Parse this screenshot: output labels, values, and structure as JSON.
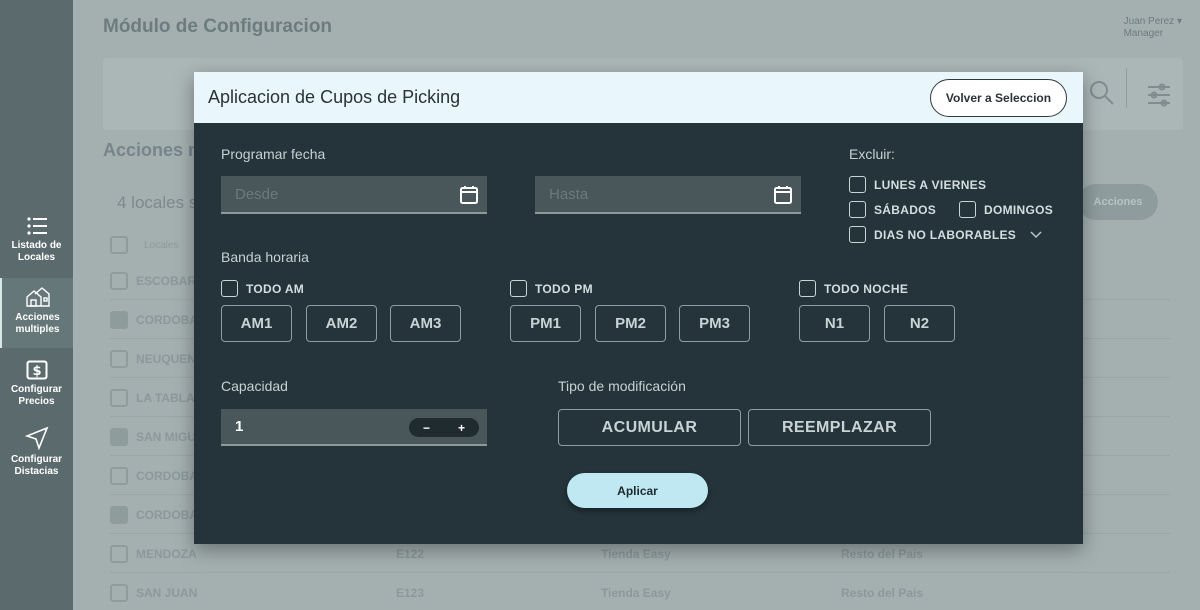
{
  "sidebar": {
    "items": [
      {
        "label_line1": "Listado de",
        "label_line2": "Locales",
        "icon": "list-icon"
      },
      {
        "label_line1": "Acciones",
        "label_line2": "multiples",
        "icon": "buildings-icon"
      },
      {
        "label_line1": "Configurar",
        "label_line2": "Precios",
        "icon": "dollar-icon"
      },
      {
        "label_line1": "Configurar",
        "label_line2": "Distacias",
        "icon": "navigation-arrow-icon"
      }
    ]
  },
  "background": {
    "title": "Módulo de Configuracion",
    "user_name": "Juan Perez",
    "user_role": "Manager",
    "section_title": "Acciones m",
    "count_text": "4 locales s",
    "actions_button": "Acciones",
    "table_header": "Locales",
    "rows": [
      {
        "name": "ESCOBAR",
        "checked": false,
        "code": "",
        "type": "",
        "region": ""
      },
      {
        "name": "CORDOBA",
        "checked": true,
        "code": "",
        "type": "",
        "region": ""
      },
      {
        "name": "NEUQUEN",
        "checked": false,
        "code": "",
        "type": "",
        "region": ""
      },
      {
        "name": "LA TABLA",
        "checked": false,
        "code": "",
        "type": "",
        "region": ""
      },
      {
        "name": "SAN MIGU",
        "checked": true,
        "code": "",
        "type": "",
        "region": ""
      },
      {
        "name": "CORDOBA",
        "checked": false,
        "code": "",
        "type": "",
        "region": ""
      },
      {
        "name": "CORDOBA",
        "checked": true,
        "code": "",
        "type": "",
        "region": ""
      },
      {
        "name": "MENDOZA",
        "checked": false,
        "code": "E122",
        "type": "Tienda Easy",
        "region": "Resto del Pais"
      },
      {
        "name": "SAN JUAN",
        "checked": false,
        "code": "E123",
        "type": "Tienda Easy",
        "region": "Resto del Pais"
      }
    ]
  },
  "modal": {
    "title": "Aplicacion de Cupos de Picking",
    "back_button": "Volver a Seleccion",
    "schedule_label": "Programar fecha",
    "from_placeholder": "Desde",
    "to_placeholder": "Hasta",
    "exclude_label": "Excluir:",
    "exclude_options": {
      "weekdays": "LUNES A VIERNES",
      "saturdays": "SÁBADOS",
      "sundays": "DOMINGOS",
      "non_working": "DIAS NO LABORABLES"
    },
    "time_band_label": "Banda horaria",
    "all_am": "TODO AM",
    "all_pm": "TODO PM",
    "all_night": "TODO NOCHE",
    "slots_am": [
      "AM1",
      "AM2",
      "AM3"
    ],
    "slots_pm": [
      "PM1",
      "PM2",
      "PM3"
    ],
    "slots_night": [
      "N1",
      "N2"
    ],
    "capacity_label": "Capacidad",
    "capacity_value": "1",
    "stepper_minus": "−",
    "stepper_plus": "+",
    "modification_label": "Tipo de modificación",
    "accumulate_button": "ACUMULAR",
    "replace_button": "REEMPLAZAR",
    "apply_button": "Aplicar"
  },
  "colors": {
    "modal_bg": "#24343a",
    "header_bg": "#e9f6fb",
    "apply_bg": "#bfe8f2",
    "field_bg": "#4a575a"
  }
}
